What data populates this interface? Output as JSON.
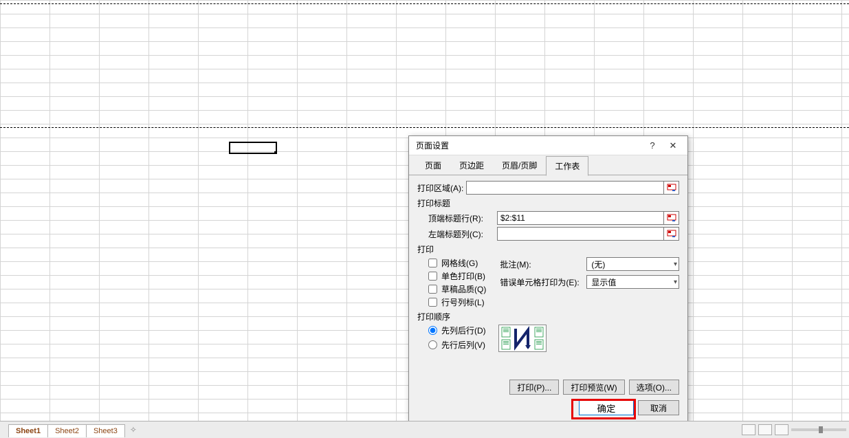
{
  "sheet_tabs": {
    "items": [
      "Sheet1",
      "Sheet2",
      "Sheet3"
    ]
  },
  "dialog": {
    "title": "页面设置",
    "help": "?",
    "close": "✕",
    "tabs": {
      "page": "页面",
      "margins": "页边距",
      "headerfooter": "页眉/页脚",
      "sheet": "工作表"
    },
    "print_area_label": "打印区域(A):",
    "print_area": "",
    "print_titles_label": "打印标题",
    "top_rows_label": "顶端标题行(R):",
    "top_rows": "$2:$11",
    "left_cols_label": "左端标题列(C):",
    "left_cols": "",
    "print_section_label": "打印",
    "gridlines": "网格线(G)",
    "black_white": "单色打印(B)",
    "draft": "草稿品质(Q)",
    "row_col_headings": "行号列标(L)",
    "comments_label": "批注(M):",
    "comments_value": "(无)",
    "errors_label": "错误单元格打印为(E):",
    "errors_value": "显示值",
    "page_order_label": "打印顺序",
    "down_then_over": "先列后行(D)",
    "over_then_down": "先行后列(V)",
    "print_btn": "打印(P)...",
    "preview_btn": "打印预览(W)",
    "options_btn": "选项(O)...",
    "ok": "确定",
    "cancel": "取消"
  }
}
